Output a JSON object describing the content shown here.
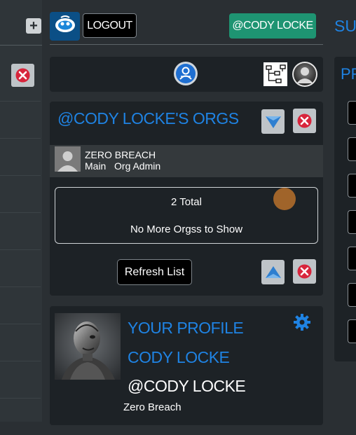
{
  "header": {
    "logout_label": "LOGOUT",
    "user_label": "@CODY LOCKE",
    "right_heading": "SUB"
  },
  "orgs": {
    "title": "@CODY LOCKE'S ORGS",
    "items": [
      {
        "name": "ZERO BREACH",
        "meta": "Main   Org Admin"
      }
    ],
    "total": "2 Total",
    "empty_message": "No More Orgss to Show",
    "refresh_label": "Refresh List"
  },
  "profile": {
    "label": "YOUR PROFILE",
    "name": "CODY LOCKE",
    "handle": "@CODY LOCKE",
    "org": "Zero Breach"
  },
  "right_panel": {
    "title": "PR"
  },
  "colors": {
    "accent_blue": "#1f83e3",
    "user_button": "#1e9472",
    "close_red": "#d8253c",
    "background": "#2a2f33",
    "panel": "#1d2226"
  },
  "icons": [
    "plus-icon",
    "close-icon",
    "app-logo-icon",
    "people-icon",
    "org-chart-icon",
    "user-avatar-icon",
    "filter-down-icon",
    "collapse-up-icon",
    "gear-icon"
  ]
}
